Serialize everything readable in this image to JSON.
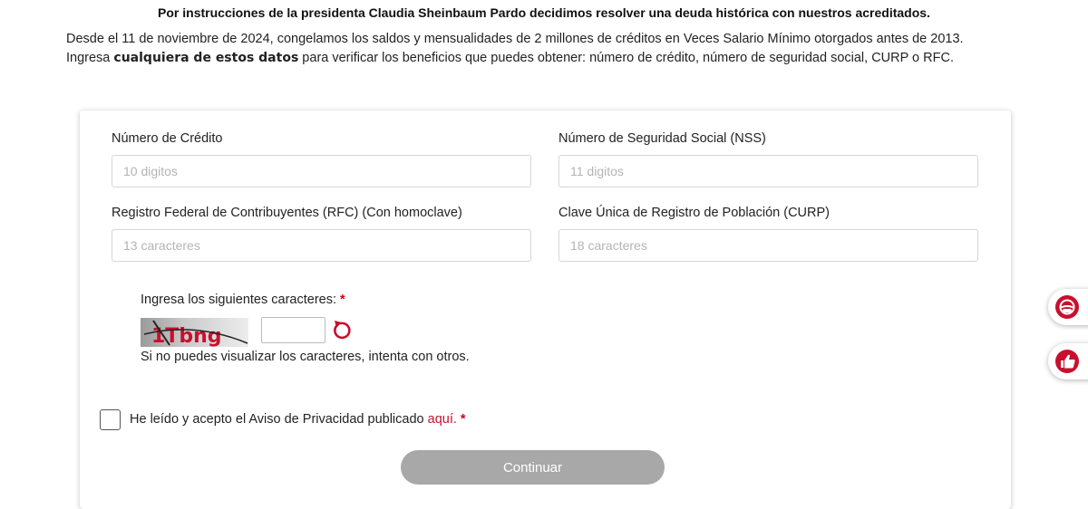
{
  "header": {
    "headline": "Por instrucciones de la presidenta Claudia Sheinbaum Pardo decidimos resolver una deuda histórica con nuestros acreditados.",
    "intro_line1": "Desde el 11 de noviembre de 2024, congelamos los saldos y mensualidades de 2 millones de créditos en Veces Salario Mínimo otorgados antes de 2013.",
    "intro_line2_prefix": "Ingresa ",
    "intro_line2_bold": "cualquiera de estos datos",
    "intro_line2_suffix": " para verificar los beneficios que puedes obtener: número de crédito, número de seguridad social, CURP o RFC."
  },
  "form": {
    "credit": {
      "label": "Número de Crédito",
      "placeholder": "10 digitos"
    },
    "nss": {
      "label": "Número de Seguridad Social (NSS)",
      "placeholder": "11 digitos"
    },
    "rfc": {
      "label": "Registro Federal de Contribuyentes (RFC) (Con homoclave)",
      "placeholder": "13 caracteres"
    },
    "curp": {
      "label": "Clave Única de Registro de Población (CURP)",
      "placeholder": "18 caracteres"
    }
  },
  "captcha": {
    "label": "Ingresa los siguientes caracteres:",
    "required_mark": "*",
    "image_text": "1Tbng",
    "help": "Si no puedes visualizar los caracteres, intenta con otros.",
    "refresh_icon": "refresh-icon"
  },
  "privacy": {
    "text": "He leído y acepto el Aviso de Privacidad publicado",
    "link": "aquí.",
    "required_mark": "*"
  },
  "actions": {
    "continue_label": "Continuar"
  },
  "floating": [
    {
      "icon": "masked-face-icon"
    },
    {
      "icon": "thumbs-up-icon"
    }
  ],
  "colors": {
    "accent_red": "#c8102e",
    "button_disabled": "#a8a8a8",
    "placeholder": "#b4b4b4"
  }
}
